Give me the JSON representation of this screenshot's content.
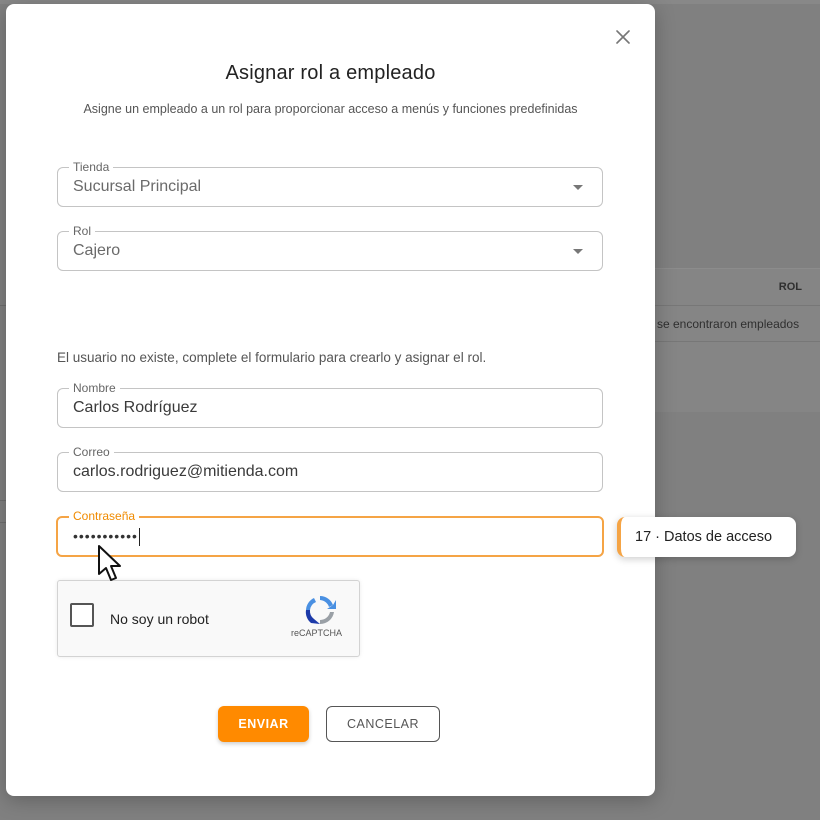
{
  "background": {
    "table": {
      "header": "ROL",
      "empty_message": "se encontraron empleados"
    }
  },
  "modal": {
    "title": "Asignar rol a empleado",
    "subtitle": "Asigne un empleado a un rol para proporcionar acceso a menús y funciones predefinidas",
    "close_icon": "close-icon",
    "fields": {
      "tienda": {
        "label": "Tienda",
        "value": "Sucursal Principal"
      },
      "rol": {
        "label": "Rol",
        "value": "Cajero"
      },
      "nombre": {
        "label": "Nombre",
        "value": "Carlos Rodríguez"
      },
      "correo": {
        "label": "Correo",
        "value": "carlos.rodriguez@mitienda.com"
      },
      "contrasena": {
        "label": "Contraseña",
        "value": "•••••••••••"
      }
    },
    "info_text": "El usuario no existe, complete el formulario para crearlo y asignar el rol.",
    "recaptcha": {
      "label": "No soy un robot",
      "brand": "reCAPTCHA"
    },
    "buttons": {
      "send": "ENVIAR",
      "cancel": "CANCELAR"
    }
  },
  "step_tooltip": {
    "text": "17 · Datos de acceso"
  },
  "colors": {
    "accent": "#ff8a00",
    "focus_border": "#f5a445"
  }
}
